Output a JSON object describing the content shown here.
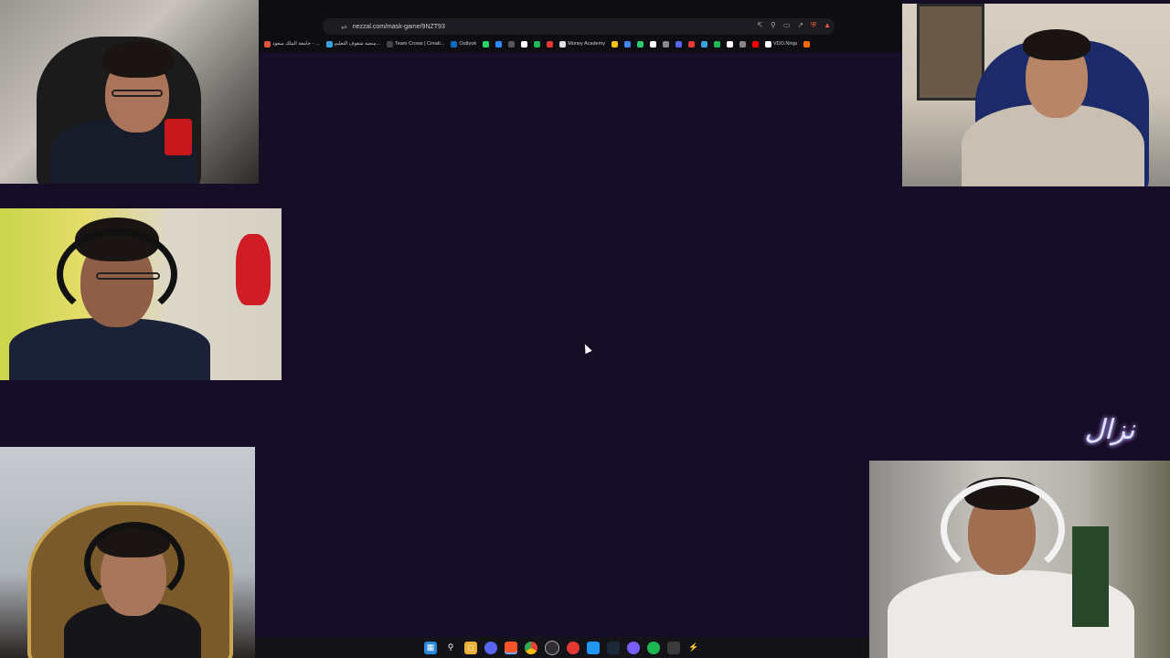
{
  "browser": {
    "url": "nezzal.com/mask-game/9NZT93",
    "bookmarks": [
      {
        "label": "جامعة الملك سعود - ...",
        "color": "#e0553b"
      },
      {
        "label": "منصة شغوف التعليم...",
        "color": "#3aa0e0"
      },
      {
        "label": "Team Crows | Creati...",
        "color": "#444444"
      },
      {
        "label": "Outlook",
        "color": "#0f6cbd"
      },
      {
        "label": "",
        "color": "#25d366"
      },
      {
        "label": "",
        "color": "#2d8cff"
      },
      {
        "label": "",
        "color": "#555555"
      },
      {
        "label": "",
        "color": "#ffffff"
      },
      {
        "label": "",
        "color": "#1db954"
      },
      {
        "label": "",
        "color": "#e53935"
      },
      {
        "label": "Money Academy",
        "color": "#dddddd"
      },
      {
        "label": "",
        "color": "#f4c20d"
      },
      {
        "label": "",
        "color": "#4285f4"
      },
      {
        "label": "",
        "color": "#2ecc71"
      },
      {
        "label": "",
        "color": "#ffffff"
      },
      {
        "label": "",
        "color": "#888888"
      },
      {
        "label": "",
        "color": "#5865f2"
      },
      {
        "label": "",
        "color": "#e53935"
      },
      {
        "label": "",
        "color": "#3aa0e0"
      },
      {
        "label": "",
        "color": "#1db954"
      },
      {
        "label": "",
        "color": "#ffffff"
      },
      {
        "label": "",
        "color": "#888888"
      },
      {
        "label": "",
        "color": "#ff0000"
      },
      {
        "label": "VDO.Ninja",
        "color": "#ffffff"
      },
      {
        "label": "",
        "color": "#ff6a00"
      }
    ]
  },
  "logo": {
    "text": "نزال"
  },
  "taskbar": {
    "icons": [
      "windows-start",
      "search",
      "file-explorer",
      "discord",
      "brave",
      "chrome",
      "obs",
      "app-red",
      "app-blue",
      "steam",
      "app-purple",
      "spotify",
      "app-gray",
      "app-bolt"
    ]
  },
  "colors": {
    "background": "#160d26",
    "taskbar": "#141418",
    "chrome": "#0e0e12"
  }
}
